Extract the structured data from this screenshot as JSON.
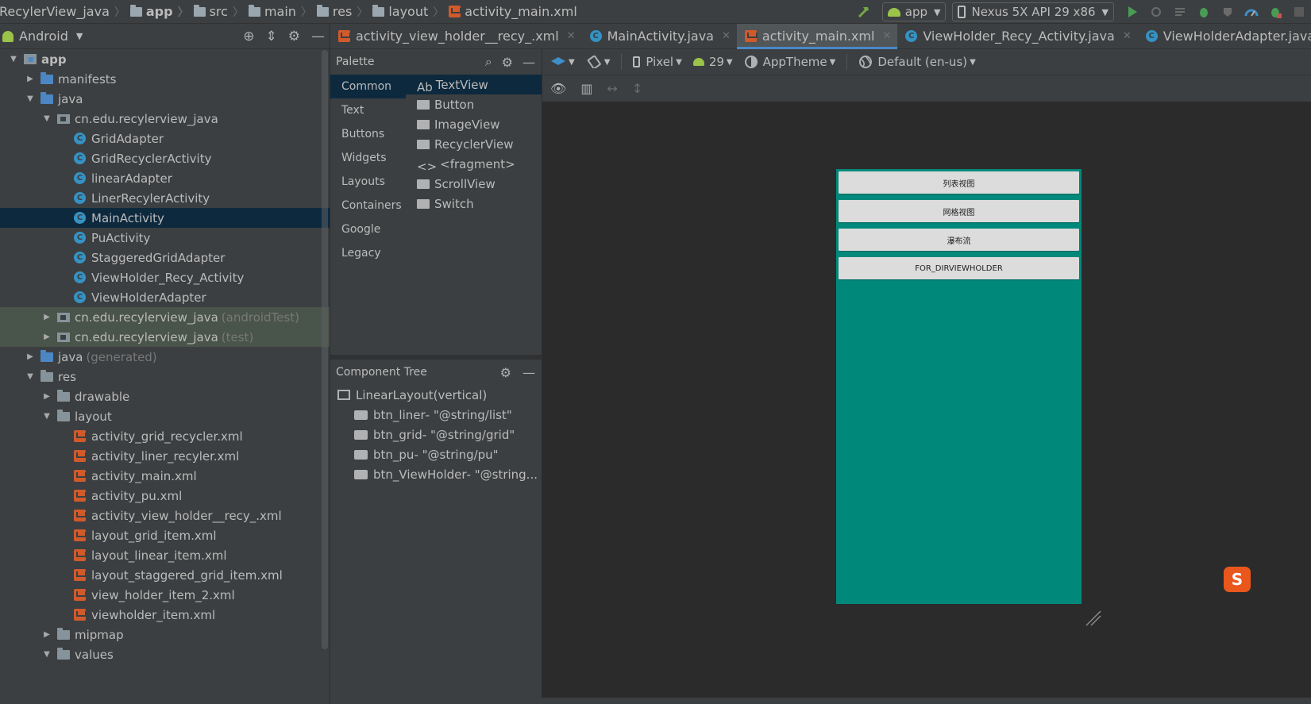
{
  "breadcrumb": [
    "RecylerView_java",
    "app",
    "src",
    "main",
    "res",
    "layout",
    "activity_main.xml"
  ],
  "run_bar": {
    "config": "app",
    "device": "Nexus 5X API 29 x86"
  },
  "project": {
    "view_mode": "Android",
    "tree": [
      {
        "label": "app",
        "level": 0,
        "arrow": "down",
        "icon": "app",
        "bold": true
      },
      {
        "label": "manifests",
        "level": 1,
        "arrow": "right",
        "icon": "folder-blue"
      },
      {
        "label": "java",
        "level": 1,
        "arrow": "down",
        "icon": "folder-blue"
      },
      {
        "label": "cn.edu.recylerview_java",
        "level": 2,
        "arrow": "down",
        "icon": "package"
      },
      {
        "label": "GridAdapter",
        "level": 3,
        "icon": "class"
      },
      {
        "label": "GridRecyclerActivity",
        "level": 3,
        "icon": "class"
      },
      {
        "label": "linearAdapter",
        "level": 3,
        "icon": "class"
      },
      {
        "label": "LinerRecylerActivity",
        "level": 3,
        "icon": "class"
      },
      {
        "label": "MainActivity",
        "level": 3,
        "icon": "class",
        "selected": true
      },
      {
        "label": "PuActivity",
        "level": 3,
        "icon": "class"
      },
      {
        "label": "StaggeredGridAdapter",
        "level": 3,
        "icon": "class"
      },
      {
        "label": "ViewHolder_Recy_Activity",
        "level": 3,
        "icon": "class"
      },
      {
        "label": "ViewHolderAdapter",
        "level": 3,
        "icon": "class"
      },
      {
        "label": "cn.edu.recylerview_java",
        "suffix": "(androidTest)",
        "level": 2,
        "arrow": "right",
        "icon": "package",
        "test": true
      },
      {
        "label": "cn.edu.recylerview_java",
        "suffix": "(test)",
        "level": 2,
        "arrow": "right",
        "icon": "package",
        "test": true
      },
      {
        "label": "java",
        "suffix": "(generated)",
        "level": 1,
        "arrow": "right",
        "icon": "folder-blue"
      },
      {
        "label": "res",
        "level": 1,
        "arrow": "down",
        "icon": "folder"
      },
      {
        "label": "drawable",
        "level": 2,
        "arrow": "right",
        "icon": "folder"
      },
      {
        "label": "layout",
        "level": 2,
        "arrow": "down",
        "icon": "folder"
      },
      {
        "label": "activity_grid_recycler.xml",
        "level": 3,
        "icon": "xml"
      },
      {
        "label": "activity_liner_recyler.xml",
        "level": 3,
        "icon": "xml"
      },
      {
        "label": "activity_main.xml",
        "level": 3,
        "icon": "xml"
      },
      {
        "label": "activity_pu.xml",
        "level": 3,
        "icon": "xml"
      },
      {
        "label": "activity_view_holder__recy_.xml",
        "level": 3,
        "icon": "xml"
      },
      {
        "label": "layout_grid_item.xml",
        "level": 3,
        "icon": "xml"
      },
      {
        "label": "layout_linear_item.xml",
        "level": 3,
        "icon": "xml"
      },
      {
        "label": "layout_staggered_grid_item.xml",
        "level": 3,
        "icon": "xml"
      },
      {
        "label": "view_holder_item_2.xml",
        "level": 3,
        "icon": "xml"
      },
      {
        "label": "viewholder_item.xml",
        "level": 3,
        "icon": "xml"
      },
      {
        "label": "mipmap",
        "level": 2,
        "arrow": "right",
        "icon": "folder"
      },
      {
        "label": "values",
        "level": 2,
        "arrow": "down",
        "icon": "folder"
      }
    ]
  },
  "tabs": [
    {
      "label": "activity_view_holder__recy_.xml",
      "icon": "xml"
    },
    {
      "label": "MainActivity.java",
      "icon": "class"
    },
    {
      "label": "activity_main.xml",
      "icon": "xml",
      "active": true
    },
    {
      "label": "ViewHolder_Recy_Activity.java",
      "icon": "class"
    },
    {
      "label": "ViewHolderAdapter.java",
      "icon": "class"
    }
  ],
  "palette": {
    "title": "Palette",
    "categories": [
      "Common",
      "Text",
      "Buttons",
      "Widgets",
      "Layouts",
      "Containers",
      "Google",
      "Legacy"
    ],
    "active_category": "Common",
    "items": [
      {
        "label": "TextView",
        "prefix": "Ab",
        "active": true
      },
      {
        "label": "Button"
      },
      {
        "label": "ImageView"
      },
      {
        "label": "RecyclerView"
      },
      {
        "label": "<fragment>",
        "prefix": "<>"
      },
      {
        "label": "ScrollView"
      },
      {
        "label": "Switch"
      }
    ]
  },
  "component_tree": {
    "title": "Component Tree",
    "root": "LinearLayout",
    "root_suffix": "(vertical)",
    "children": [
      {
        "id": "btn_liner",
        "attr": "- \"@string/list\""
      },
      {
        "id": "btn_grid",
        "attr": "- \"@string/grid\""
      },
      {
        "id": "btn_pu",
        "attr": "- \"@string/pu\""
      },
      {
        "id": "btn_ViewHolder",
        "attr": "- \"@string..."
      }
    ]
  },
  "design_toolbar": {
    "device": "Pixel",
    "api": "29",
    "theme": "AppTheme",
    "locale": "Default (en-us)"
  },
  "preview": {
    "background": "#00897b",
    "buttons": [
      "列表视图",
      "网格视图",
      "瀑布流",
      "FOR_DIRVIEWHOLDER"
    ]
  },
  "ime_badge": "S"
}
